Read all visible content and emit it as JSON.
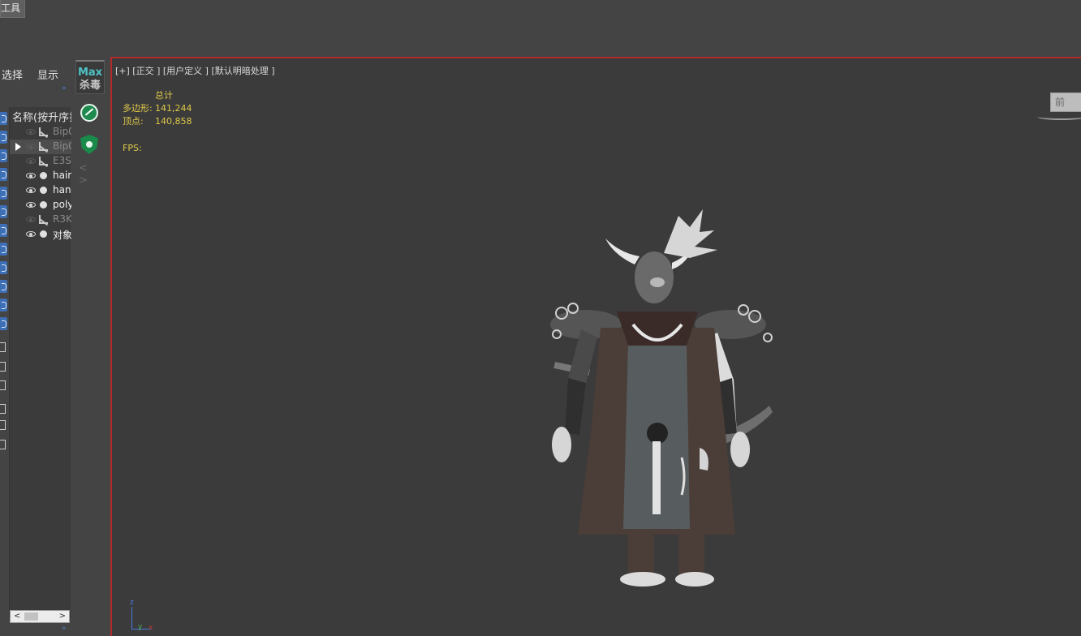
{
  "top_toolbar": {
    "tool_tab_label": "工具"
  },
  "explorer": {
    "menu_select": "选择",
    "menu_display": "显示",
    "more_chevron": "»",
    "column_header": "名称(按升序排",
    "objects": [
      {
        "name": "Bip0",
        "visible": false,
        "type": "bone",
        "dim": true
      },
      {
        "name": "Bip0",
        "visible": false,
        "type": "bone",
        "dim": true,
        "selected": true,
        "arrow": true
      },
      {
        "name": "E3S",
        "visible": false,
        "type": "bone",
        "dim": true
      },
      {
        "name": "hair",
        "visible": true,
        "type": "object",
        "dim": false
      },
      {
        "name": "han",
        "visible": true,
        "type": "object",
        "dim": false
      },
      {
        "name": "poly",
        "visible": true,
        "type": "object",
        "dim": false
      },
      {
        "name": "R3K",
        "visible": false,
        "type": "bone",
        "dim": true
      },
      {
        "name": "对象",
        "visible": true,
        "type": "object",
        "dim": false
      }
    ],
    "scroll_left": "<",
    "scroll_right": ">",
    "bottom_chevron": "»"
  },
  "plugin_strip": {
    "logo_line1": "Max",
    "logo_line2": "杀毒",
    "nav_arrows": "< >"
  },
  "viewport": {
    "label": "[+] [正交 ] [用户定义 ] [默认明暗处理 ]",
    "stats": {
      "header": "总计",
      "polygons_label": "多边形:",
      "polygons_value": "141,244",
      "vertices_label": "顶点:",
      "vertices_value": "140,858",
      "fps_label": "FPS:"
    },
    "viewcube_label": "前",
    "axis": {
      "z": "z",
      "y": "y",
      "x": "x"
    }
  },
  "colors": {
    "viewport_border": "#b32828",
    "stats_text": "#e0c94a",
    "accent_blue": "#3d6fb6",
    "plugin_green": "#1f8a4f"
  }
}
